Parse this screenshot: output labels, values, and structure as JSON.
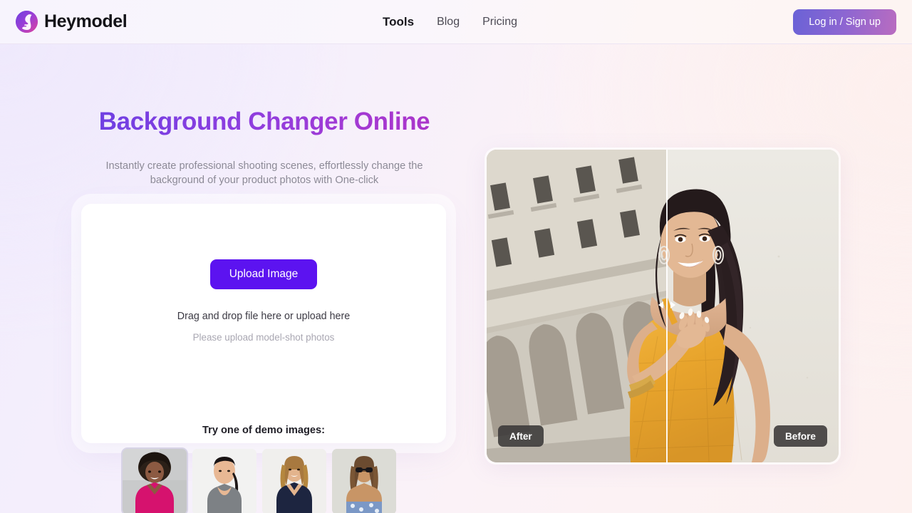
{
  "header": {
    "brand_name": "Heymodel",
    "logo_icon": "heymodel-face-logo",
    "nav": [
      {
        "label": "Tools",
        "active": true
      },
      {
        "label": "Blog",
        "active": false
      },
      {
        "label": "Pricing",
        "active": false
      }
    ],
    "login_label": "Log in / Sign up"
  },
  "hero": {
    "title": "Background Changer Online",
    "subtitle": "Instantly create professional shooting scenes, effortlessly change the background of your product photos with One-click"
  },
  "upload": {
    "button_label": "Upload Image",
    "drag_text": "Drag and drop file here or upload here",
    "hint_text": "Please upload model-shot photos"
  },
  "demos": {
    "label": "Try one of demo images:",
    "items": [
      {
        "alt": "woman-in-pink-top",
        "selected": true
      },
      {
        "alt": "woman-in-grey-tank-top",
        "selected": false
      },
      {
        "alt": "woman-in-navy-dress",
        "selected": false
      },
      {
        "alt": "woman-with-sunglasses",
        "selected": false
      }
    ]
  },
  "comparison": {
    "after_label": "After",
    "before_label": "Before",
    "slider_position_percent": 51,
    "after_alt": "model-with-stone-building-background",
    "before_alt": "model-with-plain-cream-wall-background",
    "handle_icon": "left-right-arrows-icon"
  },
  "colors": {
    "accent_purple": "#5c13f0",
    "title_gradient_start": "#6e3fe2",
    "title_gradient_end": "#ab34c9",
    "login_gradient_start": "#6a62d6",
    "login_gradient_end": "#b96cc0",
    "page_bg_left": "#f1ecfd",
    "page_bg_right": "#fdf1ef"
  }
}
